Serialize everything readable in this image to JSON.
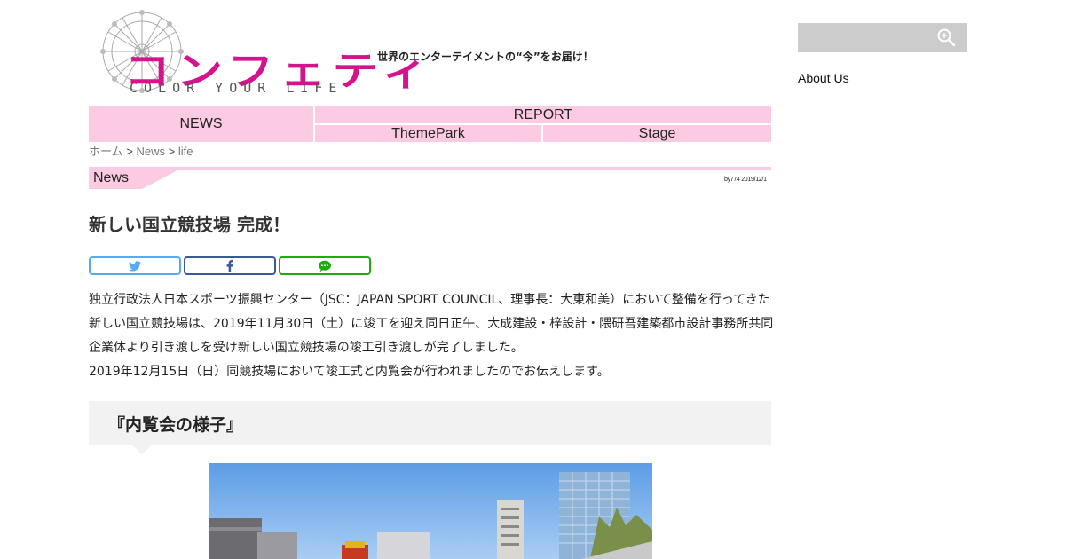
{
  "header": {
    "logo_text": "コンフェティ",
    "logo_tagline": "COLOR YOUR LIFE",
    "tagline": "世界のエンターテイメントの“今”をお届け！"
  },
  "nav": {
    "news": "NEWS",
    "report": "REPORT",
    "themepark": "ThemePark",
    "stage": "Stage"
  },
  "breadcrumb": {
    "home": "ホーム",
    "sep1": ">",
    "news": "News",
    "sep2": ">",
    "current": "life"
  },
  "article": {
    "category": "News",
    "byline": "by774 2019/12/1",
    "title": "新しい国立競技場 完成！",
    "share": {
      "twitter_icon": "twitter-icon",
      "facebook_icon": "facebook-icon",
      "line_icon": "line-icon"
    },
    "paragraphs": [
      "独立行政法人日本スポーツ振興センター（JSC：JAPAN SPORT COUNCIL、理事長：大東和美）において整備を行ってきた新しい国立競技場は、2019年11月30日（土）に竣工を迎え同日正午、大成建設・梓設計・隈研吾建築都市設計事務所共同企業体より引き渡しを受け新しい国立競技場の竣工引き渡しが完了しました。",
      "2019年12月15日（日）同競技場において竣工式と内覧会が行われましたのでお伝えします。"
    ],
    "section_heading": "『内覧会の様子』"
  },
  "sidebar": {
    "search_placeholder": "",
    "about": "About Us"
  },
  "colors": {
    "brand_pink": "#d4148c",
    "nav_pink": "#fccbe3",
    "twitter": "#55acee",
    "facebook": "#3b5998",
    "line": "#1dac0a"
  }
}
